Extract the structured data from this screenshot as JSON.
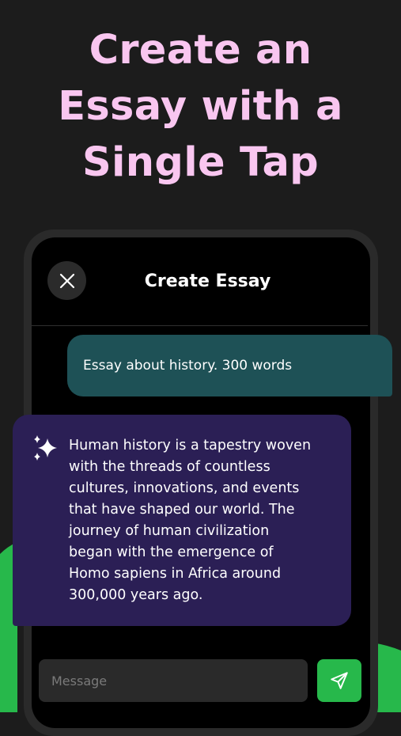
{
  "hero": {
    "lines": [
      "Create an",
      "Essay with a",
      "Single Tap"
    ]
  },
  "screen": {
    "title": "Create Essay",
    "close_icon": "close-icon"
  },
  "conversation": {
    "user_message": "Essay about history. 300 words",
    "ai_icon": "sparkle-icon",
    "ai_response_lines": [
      "Human history is a tapestry woven",
      "with the threads of countless",
      "cultures, innovations, and events",
      "that have shaped our world. The",
      "journey of human civilization",
      "began with the emergence of",
      "Homo sapiens in Africa around",
      "300,000 years ago."
    ]
  },
  "composer": {
    "placeholder": "Message",
    "send_icon": "send-icon"
  },
  "colors": {
    "background": "#1c1c1c",
    "hero_text": "#f9c6f0",
    "accent_green": "#27b84b",
    "user_bubble": "#1e5156",
    "ai_bubble": "#2b1f55",
    "screen": "#000000"
  }
}
